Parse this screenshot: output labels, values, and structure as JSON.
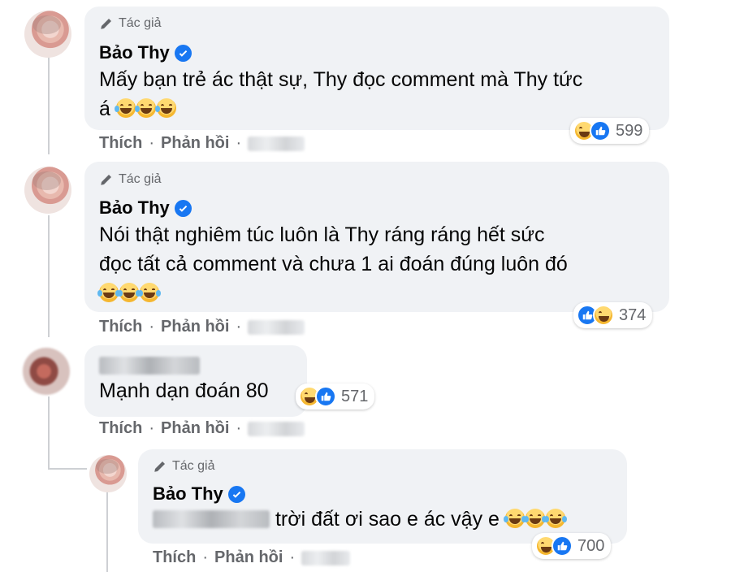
{
  "labels": {
    "author_badge": "Tác giả",
    "like": "Thích",
    "reply": "Phản hồi",
    "separator": "·"
  },
  "comments": [
    {
      "author": "Bảo Thy",
      "verified": true,
      "is_author": true,
      "text_line1": "Mấy bạn trẻ ác thật sự, Thy đọc comment mà Thy tức",
      "text_line2": "á",
      "emoji": [
        "rofl",
        "rofl",
        "rofl"
      ],
      "reactions": [
        "haha",
        "like"
      ],
      "reaction_count": "599"
    },
    {
      "author": "Bảo Thy",
      "verified": true,
      "is_author": true,
      "text_line1": "Nói thật nghiêm túc luôn là Thy ráng ráng hết sức",
      "text_line2": "đọc tất cả comment và chưa 1 ai đoán đúng luôn đó",
      "emoji": [
        "joy",
        "joy",
        "joy"
      ],
      "reactions": [
        "like",
        "haha"
      ],
      "reaction_count": "374"
    },
    {
      "author": "(blurred)",
      "verified": false,
      "is_author": false,
      "text": "Mạnh dạn đoán 80",
      "reactions": [
        "haha",
        "like"
      ],
      "reaction_count": "571"
    }
  ],
  "reply": {
    "author": "Bảo Thy",
    "verified": true,
    "is_author": true,
    "text": "trời đất ơi sao e ác vậy e",
    "emoji": [
      "joy",
      "joy",
      "joy"
    ],
    "reactions": [
      "haha",
      "like"
    ],
    "reaction_count": "700"
  },
  "colors": {
    "bubble": "#f0f2f5",
    "verified": "#1877f2",
    "secondary_text": "#65676b"
  }
}
